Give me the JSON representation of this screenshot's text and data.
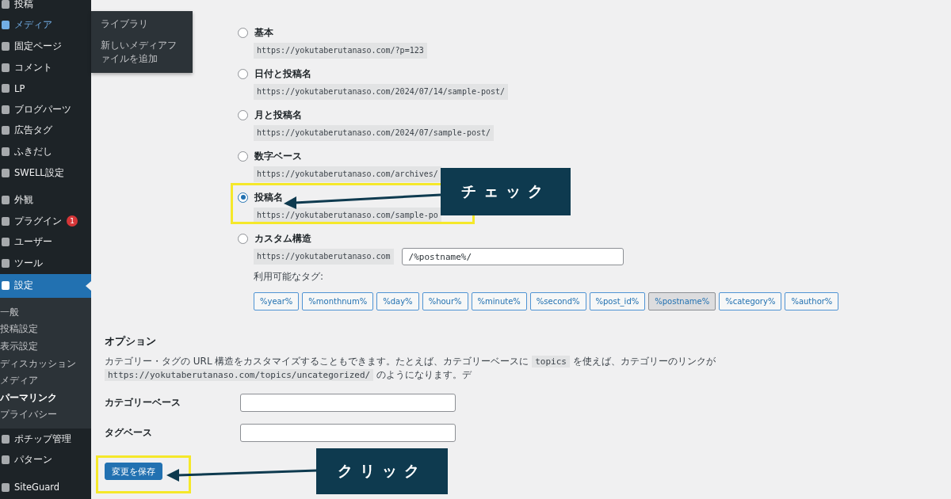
{
  "sidebar": {
    "items": [
      {
        "label": "投稿",
        "hovered": false,
        "selected": false
      },
      {
        "label": "メディア",
        "hovered": true,
        "selected": false
      },
      {
        "label": "固定ページ",
        "hovered": false,
        "selected": false
      },
      {
        "label": "コメント",
        "hovered": false,
        "selected": false
      },
      {
        "label": "LP",
        "hovered": false,
        "selected": false
      },
      {
        "label": "ブログパーツ",
        "hovered": false,
        "selected": false
      },
      {
        "label": "広告タグ",
        "hovered": false,
        "selected": false
      },
      {
        "label": "ふきだし",
        "hovered": false,
        "selected": false
      },
      {
        "label": "SWELL設定",
        "hovered": false,
        "selected": false
      },
      {
        "label": "外観",
        "hovered": false,
        "selected": false
      },
      {
        "label": "プラグイン",
        "hovered": false,
        "selected": false,
        "badge": "1"
      },
      {
        "label": "ユーザー",
        "hovered": false,
        "selected": false
      },
      {
        "label": "ツール",
        "hovered": false,
        "selected": false
      },
      {
        "label": "設定",
        "hovered": false,
        "selected": true,
        "children": [
          {
            "label": "一般",
            "selected": false
          },
          {
            "label": "投稿設定",
            "selected": false
          },
          {
            "label": "表示設定",
            "selected": false
          },
          {
            "label": "ディスカッション",
            "selected": false
          },
          {
            "label": "メディア",
            "selected": false
          },
          {
            "label": "パーマリンク",
            "selected": true
          },
          {
            "label": "プライバシー",
            "selected": false
          }
        ]
      },
      {
        "label": "ポチップ管理",
        "hovered": false,
        "selected": false
      },
      {
        "label": "パターン",
        "hovered": false,
        "selected": false
      },
      {
        "label": "SiteGuard",
        "hovered": false,
        "selected": false
      }
    ]
  },
  "flyout": {
    "items": [
      "ライブラリ",
      "新しいメディアファイルを追加"
    ]
  },
  "structures": [
    {
      "kind": "preset",
      "label": "基本",
      "url": "https://yokutaberutanaso.com/?p=123",
      "selected": false
    },
    {
      "kind": "preset",
      "label": "日付と投稿名",
      "url": "https://yokutaberutanaso.com/2024/07/14/sample-post/",
      "selected": false
    },
    {
      "kind": "preset",
      "label": "月と投稿名",
      "url": "https://yokutaberutanaso.com/2024/07/sample-post/",
      "selected": false
    },
    {
      "kind": "preset",
      "label": "数字ベース",
      "url": "https://yokutaberutanaso.com/archives/",
      "selected": false
    },
    {
      "kind": "preset",
      "label": "投稿名",
      "url": "https://yokutaberutanaso.com/sample-po",
      "selected": true
    },
    {
      "kind": "custom",
      "label": "カスタム構造",
      "url": "https://yokutaberutanaso.com",
      "value": "/%postname%/",
      "selected": false
    }
  ],
  "tags_label": "利用可能なタグ:",
  "tags": [
    {
      "label": "%year%",
      "selected": false
    },
    {
      "label": "%monthnum%",
      "selected": false
    },
    {
      "label": "%day%",
      "selected": false
    },
    {
      "label": "%hour%",
      "selected": false
    },
    {
      "label": "%minute%",
      "selected": false
    },
    {
      "label": "%second%",
      "selected": false
    },
    {
      "label": "%post_id%",
      "selected": false
    },
    {
      "label": "%postname%",
      "selected": true
    },
    {
      "label": "%category%",
      "selected": false
    },
    {
      "label": "%author%",
      "selected": false
    }
  ],
  "options": {
    "heading": "オプション",
    "description": [
      {
        "kind": "text",
        "text": "カテゴリー・タグの URL 構造をカスタマイズすることもできます。たとえば、カテゴリーベースに "
      },
      {
        "kind": "code",
        "text": "topics"
      },
      {
        "kind": "text",
        "text": " を使えば、カテゴリーのリンクが "
      },
      {
        "kind": "code",
        "text": "https://yokutaberutanaso.com/topics/uncategorized/"
      },
      {
        "kind": "text",
        "text": " のようになります。デ"
      }
    ],
    "fields": [
      {
        "label": "カテゴリーベース"
      },
      {
        "label": "タグベース"
      }
    ]
  },
  "save_button": "変更を保存",
  "annotations": [
    {
      "label": "チェック"
    },
    {
      "label": "クリック"
    }
  ]
}
